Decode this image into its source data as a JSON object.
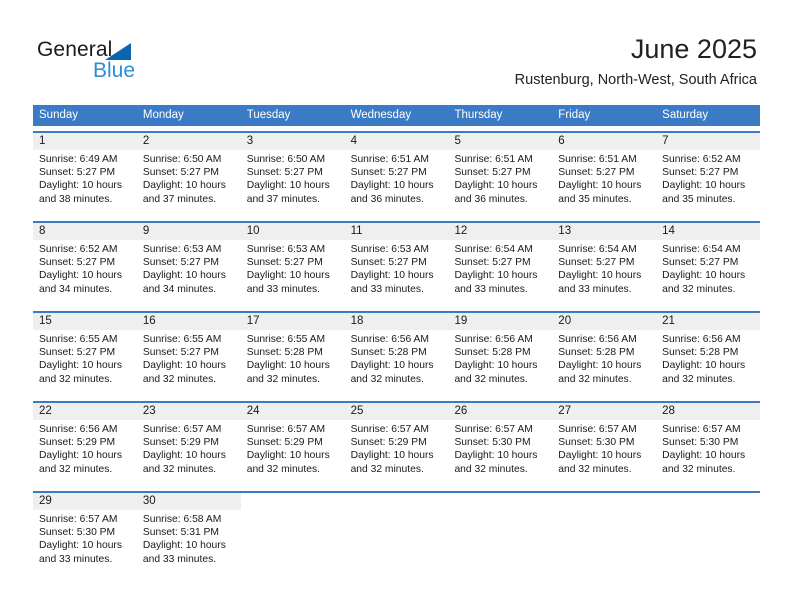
{
  "logo": {
    "word1": "General",
    "word2": "Blue",
    "triangle_color": "#0b64b0",
    "word2_color": "#2c8fd4"
  },
  "header": {
    "title": "June 2025",
    "location": "Rustenburg, North-West, South Africa"
  },
  "theme": {
    "header_bg": "#3b7ac4",
    "header_text": "#ffffff",
    "daynum_bg": "#efefef",
    "cell_bg": "#ffffff",
    "text": "#1a1a1a"
  },
  "weekdays": [
    "Sunday",
    "Monday",
    "Tuesday",
    "Wednesday",
    "Thursday",
    "Friday",
    "Saturday"
  ],
  "weeks": [
    [
      {
        "day": "1",
        "sunrise": "Sunrise: 6:49 AM",
        "sunset": "Sunset: 5:27 PM",
        "daylight1": "Daylight: 10 hours",
        "daylight2": "and 38 minutes."
      },
      {
        "day": "2",
        "sunrise": "Sunrise: 6:50 AM",
        "sunset": "Sunset: 5:27 PM",
        "daylight1": "Daylight: 10 hours",
        "daylight2": "and 37 minutes."
      },
      {
        "day": "3",
        "sunrise": "Sunrise: 6:50 AM",
        "sunset": "Sunset: 5:27 PM",
        "daylight1": "Daylight: 10 hours",
        "daylight2": "and 37 minutes."
      },
      {
        "day": "4",
        "sunrise": "Sunrise: 6:51 AM",
        "sunset": "Sunset: 5:27 PM",
        "daylight1": "Daylight: 10 hours",
        "daylight2": "and 36 minutes."
      },
      {
        "day": "5",
        "sunrise": "Sunrise: 6:51 AM",
        "sunset": "Sunset: 5:27 PM",
        "daylight1": "Daylight: 10 hours",
        "daylight2": "and 36 minutes."
      },
      {
        "day": "6",
        "sunrise": "Sunrise: 6:51 AM",
        "sunset": "Sunset: 5:27 PM",
        "daylight1": "Daylight: 10 hours",
        "daylight2": "and 35 minutes."
      },
      {
        "day": "7",
        "sunrise": "Sunrise: 6:52 AM",
        "sunset": "Sunset: 5:27 PM",
        "daylight1": "Daylight: 10 hours",
        "daylight2": "and 35 minutes."
      }
    ],
    [
      {
        "day": "8",
        "sunrise": "Sunrise: 6:52 AM",
        "sunset": "Sunset: 5:27 PM",
        "daylight1": "Daylight: 10 hours",
        "daylight2": "and 34 minutes."
      },
      {
        "day": "9",
        "sunrise": "Sunrise: 6:53 AM",
        "sunset": "Sunset: 5:27 PM",
        "daylight1": "Daylight: 10 hours",
        "daylight2": "and 34 minutes."
      },
      {
        "day": "10",
        "sunrise": "Sunrise: 6:53 AM",
        "sunset": "Sunset: 5:27 PM",
        "daylight1": "Daylight: 10 hours",
        "daylight2": "and 33 minutes."
      },
      {
        "day": "11",
        "sunrise": "Sunrise: 6:53 AM",
        "sunset": "Sunset: 5:27 PM",
        "daylight1": "Daylight: 10 hours",
        "daylight2": "and 33 minutes."
      },
      {
        "day": "12",
        "sunrise": "Sunrise: 6:54 AM",
        "sunset": "Sunset: 5:27 PM",
        "daylight1": "Daylight: 10 hours",
        "daylight2": "and 33 minutes."
      },
      {
        "day": "13",
        "sunrise": "Sunrise: 6:54 AM",
        "sunset": "Sunset: 5:27 PM",
        "daylight1": "Daylight: 10 hours",
        "daylight2": "and 33 minutes."
      },
      {
        "day": "14",
        "sunrise": "Sunrise: 6:54 AM",
        "sunset": "Sunset: 5:27 PM",
        "daylight1": "Daylight: 10 hours",
        "daylight2": "and 32 minutes."
      }
    ],
    [
      {
        "day": "15",
        "sunrise": "Sunrise: 6:55 AM",
        "sunset": "Sunset: 5:27 PM",
        "daylight1": "Daylight: 10 hours",
        "daylight2": "and 32 minutes."
      },
      {
        "day": "16",
        "sunrise": "Sunrise: 6:55 AM",
        "sunset": "Sunset: 5:27 PM",
        "daylight1": "Daylight: 10 hours",
        "daylight2": "and 32 minutes."
      },
      {
        "day": "17",
        "sunrise": "Sunrise: 6:55 AM",
        "sunset": "Sunset: 5:28 PM",
        "daylight1": "Daylight: 10 hours",
        "daylight2": "and 32 minutes."
      },
      {
        "day": "18",
        "sunrise": "Sunrise: 6:56 AM",
        "sunset": "Sunset: 5:28 PM",
        "daylight1": "Daylight: 10 hours",
        "daylight2": "and 32 minutes."
      },
      {
        "day": "19",
        "sunrise": "Sunrise: 6:56 AM",
        "sunset": "Sunset: 5:28 PM",
        "daylight1": "Daylight: 10 hours",
        "daylight2": "and 32 minutes."
      },
      {
        "day": "20",
        "sunrise": "Sunrise: 6:56 AM",
        "sunset": "Sunset: 5:28 PM",
        "daylight1": "Daylight: 10 hours",
        "daylight2": "and 32 minutes."
      },
      {
        "day": "21",
        "sunrise": "Sunrise: 6:56 AM",
        "sunset": "Sunset: 5:28 PM",
        "daylight1": "Daylight: 10 hours",
        "daylight2": "and 32 minutes."
      }
    ],
    [
      {
        "day": "22",
        "sunrise": "Sunrise: 6:56 AM",
        "sunset": "Sunset: 5:29 PM",
        "daylight1": "Daylight: 10 hours",
        "daylight2": "and 32 minutes."
      },
      {
        "day": "23",
        "sunrise": "Sunrise: 6:57 AM",
        "sunset": "Sunset: 5:29 PM",
        "daylight1": "Daylight: 10 hours",
        "daylight2": "and 32 minutes."
      },
      {
        "day": "24",
        "sunrise": "Sunrise: 6:57 AM",
        "sunset": "Sunset: 5:29 PM",
        "daylight1": "Daylight: 10 hours",
        "daylight2": "and 32 minutes."
      },
      {
        "day": "25",
        "sunrise": "Sunrise: 6:57 AM",
        "sunset": "Sunset: 5:29 PM",
        "daylight1": "Daylight: 10 hours",
        "daylight2": "and 32 minutes."
      },
      {
        "day": "26",
        "sunrise": "Sunrise: 6:57 AM",
        "sunset": "Sunset: 5:30 PM",
        "daylight1": "Daylight: 10 hours",
        "daylight2": "and 32 minutes."
      },
      {
        "day": "27",
        "sunrise": "Sunrise: 6:57 AM",
        "sunset": "Sunset: 5:30 PM",
        "daylight1": "Daylight: 10 hours",
        "daylight2": "and 32 minutes."
      },
      {
        "day": "28",
        "sunrise": "Sunrise: 6:57 AM",
        "sunset": "Sunset: 5:30 PM",
        "daylight1": "Daylight: 10 hours",
        "daylight2": "and 32 minutes."
      }
    ],
    [
      {
        "day": "29",
        "sunrise": "Sunrise: 6:57 AM",
        "sunset": "Sunset: 5:30 PM",
        "daylight1": "Daylight: 10 hours",
        "daylight2": "and 33 minutes."
      },
      {
        "day": "30",
        "sunrise": "Sunrise: 6:58 AM",
        "sunset": "Sunset: 5:31 PM",
        "daylight1": "Daylight: 10 hours",
        "daylight2": "and 33 minutes."
      },
      {
        "day": "",
        "sunrise": "",
        "sunset": "",
        "daylight1": "",
        "daylight2": ""
      },
      {
        "day": "",
        "sunrise": "",
        "sunset": "",
        "daylight1": "",
        "daylight2": ""
      },
      {
        "day": "",
        "sunrise": "",
        "sunset": "",
        "daylight1": "",
        "daylight2": ""
      },
      {
        "day": "",
        "sunrise": "",
        "sunset": "",
        "daylight1": "",
        "daylight2": ""
      },
      {
        "day": "",
        "sunrise": "",
        "sunset": "",
        "daylight1": "",
        "daylight2": ""
      }
    ]
  ]
}
